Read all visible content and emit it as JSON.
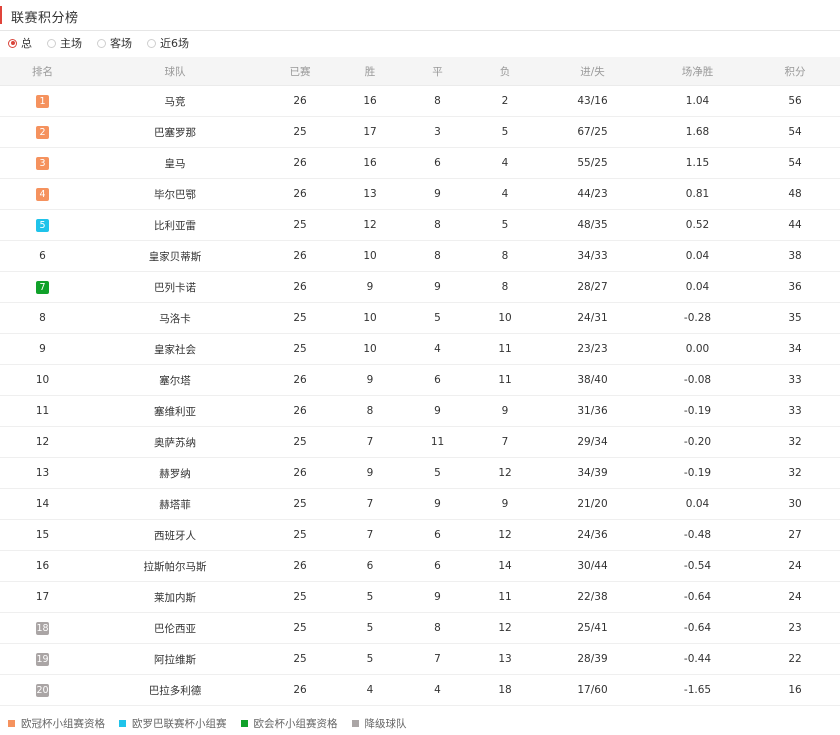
{
  "page": {
    "title": "联赛积分榜"
  },
  "filters": [
    {
      "label": "总",
      "selected": true
    },
    {
      "label": "主场",
      "selected": false
    },
    {
      "label": "客场",
      "selected": false
    },
    {
      "label": "近6场",
      "selected": false
    }
  ],
  "colors": {
    "ucl": "#f5925e",
    "uel": "#1fc3ea",
    "uecl": "#10a12a",
    "relegation": "#aaa5a5",
    "positive": "#e0443a",
    "negative": "#55a92b"
  },
  "table": {
    "headers": [
      "排名",
      "球队",
      "已赛",
      "胜",
      "平",
      "负",
      "进/失",
      "场净胜",
      "积分"
    ],
    "rows": [
      {
        "rank": "1",
        "zone": "ucl",
        "team": "马竞",
        "played": "26",
        "win": "16",
        "draw": "8",
        "loss": "2",
        "goals": "43/16",
        "gd_per_game": "1.04",
        "points": "56"
      },
      {
        "rank": "2",
        "zone": "ucl",
        "team": "巴塞罗那",
        "played": "25",
        "win": "17",
        "draw": "3",
        "loss": "5",
        "goals": "67/25",
        "gd_per_game": "1.68",
        "points": "54"
      },
      {
        "rank": "3",
        "zone": "ucl",
        "team": "皇马",
        "played": "26",
        "win": "16",
        "draw": "6",
        "loss": "4",
        "goals": "55/25",
        "gd_per_game": "1.15",
        "points": "54"
      },
      {
        "rank": "4",
        "zone": "ucl",
        "team": "毕尔巴鄂",
        "played": "26",
        "win": "13",
        "draw": "9",
        "loss": "4",
        "goals": "44/23",
        "gd_per_game": "0.81",
        "points": "48"
      },
      {
        "rank": "5",
        "zone": "uel",
        "team": "比利亚雷",
        "played": "25",
        "win": "12",
        "draw": "8",
        "loss": "5",
        "goals": "48/35",
        "gd_per_game": "0.52",
        "points": "44"
      },
      {
        "rank": "6",
        "zone": "",
        "team": "皇家贝蒂斯",
        "played": "26",
        "win": "10",
        "draw": "8",
        "loss": "8",
        "goals": "34/33",
        "gd_per_game": "0.04",
        "points": "38"
      },
      {
        "rank": "7",
        "zone": "uecl",
        "team": "巴列卡诺",
        "played": "26",
        "win": "9",
        "draw": "9",
        "loss": "8",
        "goals": "28/27",
        "gd_per_game": "0.04",
        "points": "36"
      },
      {
        "rank": "8",
        "zone": "",
        "team": "马洛卡",
        "played": "25",
        "win": "10",
        "draw": "5",
        "loss": "10",
        "goals": "24/31",
        "gd_per_game": "-0.28",
        "points": "35"
      },
      {
        "rank": "9",
        "zone": "",
        "team": "皇家社会",
        "played": "25",
        "win": "10",
        "draw": "4",
        "loss": "11",
        "goals": "23/23",
        "gd_per_game": "0.00",
        "points": "34"
      },
      {
        "rank": "10",
        "zone": "",
        "team": "塞尔塔",
        "played": "26",
        "win": "9",
        "draw": "6",
        "loss": "11",
        "goals": "38/40",
        "gd_per_game": "-0.08",
        "points": "33"
      },
      {
        "rank": "11",
        "zone": "",
        "team": "塞维利亚",
        "played": "26",
        "win": "8",
        "draw": "9",
        "loss": "9",
        "goals": "31/36",
        "gd_per_game": "-0.19",
        "points": "33"
      },
      {
        "rank": "12",
        "zone": "",
        "team": "奥萨苏纳",
        "played": "25",
        "win": "7",
        "draw": "11",
        "loss": "7",
        "goals": "29/34",
        "gd_per_game": "-0.20",
        "points": "32"
      },
      {
        "rank": "13",
        "zone": "",
        "team": "赫罗纳",
        "played": "26",
        "win": "9",
        "draw": "5",
        "loss": "12",
        "goals": "34/39",
        "gd_per_game": "-0.19",
        "points": "32"
      },
      {
        "rank": "14",
        "zone": "",
        "team": "赫塔菲",
        "played": "25",
        "win": "7",
        "draw": "9",
        "loss": "9",
        "goals": "21/20",
        "gd_per_game": "0.04",
        "points": "30"
      },
      {
        "rank": "15",
        "zone": "",
        "team": "西班牙人",
        "played": "25",
        "win": "7",
        "draw": "6",
        "loss": "12",
        "goals": "24/36",
        "gd_per_game": "-0.48",
        "points": "27"
      },
      {
        "rank": "16",
        "zone": "",
        "team": "拉斯帕尔马斯",
        "played": "26",
        "win": "6",
        "draw": "6",
        "loss": "14",
        "goals": "30/44",
        "gd_per_game": "-0.54",
        "points": "24"
      },
      {
        "rank": "17",
        "zone": "",
        "team": "莱加内斯",
        "played": "25",
        "win": "5",
        "draw": "9",
        "loss": "11",
        "goals": "22/38",
        "gd_per_game": "-0.64",
        "points": "24"
      },
      {
        "rank": "18",
        "zone": "relegation",
        "team": "巴伦西亚",
        "played": "25",
        "win": "5",
        "draw": "8",
        "loss": "12",
        "goals": "25/41",
        "gd_per_game": "-0.64",
        "points": "23"
      },
      {
        "rank": "19",
        "zone": "relegation",
        "team": "阿拉维斯",
        "played": "25",
        "win": "5",
        "draw": "7",
        "loss": "13",
        "goals": "28/39",
        "gd_per_game": "-0.44",
        "points": "22"
      },
      {
        "rank": "20",
        "zone": "relegation",
        "team": "巴拉多利德",
        "played": "26",
        "win": "4",
        "draw": "4",
        "loss": "18",
        "goals": "17/60",
        "gd_per_game": "-1.65",
        "points": "16"
      }
    ]
  },
  "legend": [
    {
      "label": "欧冠杯小组赛资格",
      "zone": "ucl"
    },
    {
      "label": "欧罗巴联赛杯小组赛",
      "zone": "uel"
    },
    {
      "label": "欧会杯小组赛资格",
      "zone": "uecl"
    },
    {
      "label": "降级球队",
      "zone": "relegation"
    }
  ]
}
